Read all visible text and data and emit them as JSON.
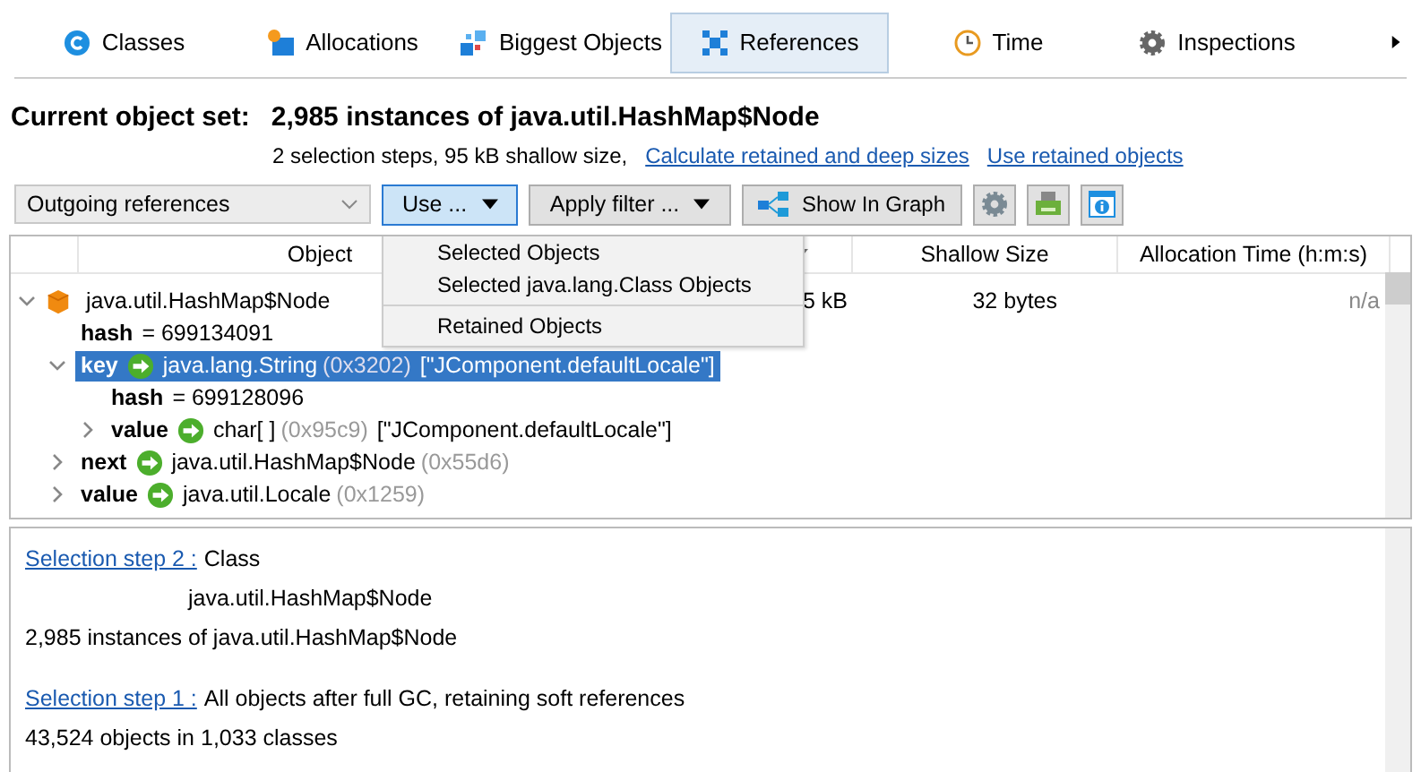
{
  "tabs": [
    {
      "label": "Classes",
      "selected": false
    },
    {
      "label": "Allocations",
      "selected": false
    },
    {
      "label": "Biggest Objects",
      "selected": false
    },
    {
      "label": "References",
      "selected": true
    },
    {
      "label": "Time",
      "selected": false
    },
    {
      "label": "Inspections",
      "selected": false
    }
  ],
  "heading": {
    "label": "Current object set:",
    "value": "2,985 instances of java.util.HashMap$Node"
  },
  "summary": {
    "text": "2 selection steps, 95 kB shallow size,",
    "links": [
      "Calculate retained and deep sizes",
      "Use retained objects"
    ]
  },
  "toolbar": {
    "view_select": "Outgoing references",
    "use_button": "Use ...",
    "filter_button": "Apply filter ...",
    "graph_button": "Show In Graph"
  },
  "use_menu": {
    "items": [
      {
        "label": "Selected Objects",
        "separator_before": false
      },
      {
        "label": "Selected java.lang.Class Objects",
        "separator_before": false
      },
      {
        "label": "Retained Objects",
        "separator_before": true
      }
    ]
  },
  "table": {
    "columns": [
      "Object",
      "Shallow Size",
      "Allocation Time (h:m:s)"
    ],
    "rows": [
      {
        "kind": "instance",
        "type": "java.util.HashMap$Node",
        "retained": "5 kB",
        "shallow": "32 bytes",
        "allocation_time": "n/a",
        "expanded": true,
        "selected": false,
        "children": [
          {
            "kind": "field",
            "name": "hash",
            "value": "= 699134091"
          },
          {
            "kind": "reference",
            "name": "key",
            "type": "java.lang.String",
            "address": "(0x3202)",
            "extra": "[\"JComponent.defaultLocale\"]",
            "expanded": true,
            "selected": true,
            "children": [
              {
                "kind": "field",
                "name": "hash",
                "value": "= 699128096"
              },
              {
                "kind": "reference",
                "name": "value",
                "type": "char[ ]",
                "address": "(0x95c9)",
                "extra": "[\"JComponent.defaultLocale\"]",
                "expanded": false,
                "selected": false
              }
            ]
          },
          {
            "kind": "reference",
            "name": "next",
            "type": "java.util.HashMap$Node",
            "address": "(0x55d6)",
            "expanded": false,
            "selected": false
          },
          {
            "kind": "reference",
            "name": "value",
            "type": "java.util.Locale",
            "address": "(0x1259)",
            "expanded": false,
            "selected": false
          }
        ]
      }
    ]
  },
  "selection_steps": [
    {
      "link": "Selection step 2 :",
      "label": "Class",
      "detail": "java.util.HashMap$Node",
      "result": "2,985 instances of java.util.HashMap$Node"
    },
    {
      "link": "Selection step 1 :",
      "label": "All objects after full GC, retaining soft references",
      "result": "43,524 objects in 1,033 classes"
    }
  ]
}
